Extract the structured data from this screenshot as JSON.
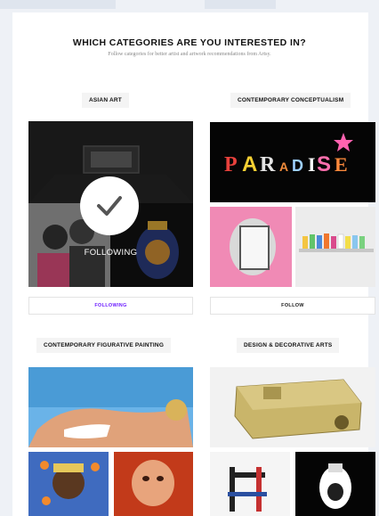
{
  "header": {
    "title": "WHICH CATEGORIES ARE YOU INTERESTED IN?",
    "subtitle": "Follow categories for better artist and artwork recommendations from Artsy."
  },
  "categories": [
    {
      "title": "ASIAN ART",
      "button": "FOLLOWING",
      "state": "following",
      "overlay_label": "FOLLOWING"
    },
    {
      "title": "CONTEMPORARY CONCEPTUALISM",
      "button": "FOLLOW",
      "state": "not-following",
      "artwork_text": "PARADISE"
    },
    {
      "title": "CONTEMPORARY FIGURATIVE PAINTING"
    },
    {
      "title": "DESIGN & DECORATIVE ARTS"
    }
  ],
  "colors": {
    "accent_purple": "#6e1fff",
    "page_bg": "#eef1f6",
    "card_bg": "#ffffff"
  },
  "icons": [
    "checkmark-icon",
    "star-icon"
  ]
}
